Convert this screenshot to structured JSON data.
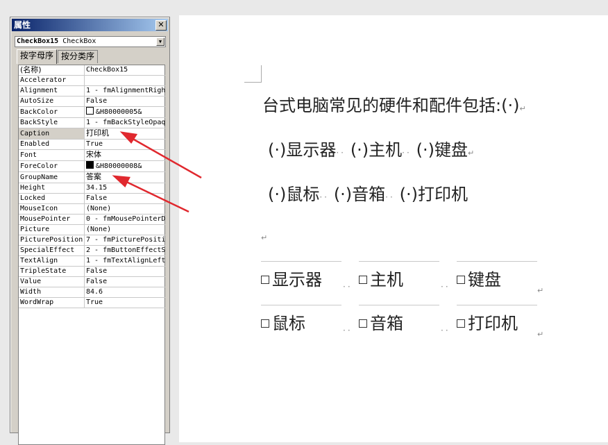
{
  "properties_window": {
    "title": "属性",
    "close_glyph": "✕",
    "object_selector": {
      "name": "CheckBox15",
      "type": "CheckBox"
    },
    "tabs": [
      {
        "label": "按字母序",
        "active": true
      },
      {
        "label": "按分类序",
        "active": false
      }
    ],
    "rows": [
      {
        "key": "(名称)",
        "value": "CheckBox15"
      },
      {
        "key": "Accelerator",
        "value": ""
      },
      {
        "key": "Alignment",
        "value": "1 - fmAlignmentRigh"
      },
      {
        "key": "AutoSize",
        "value": "False"
      },
      {
        "key": "BackColor",
        "value": "&H80000005&",
        "swatch": "#ffffff"
      },
      {
        "key": "BackStyle",
        "value": "1 - fmBackStyleOpaq"
      },
      {
        "key": "Caption",
        "value": "打印机",
        "selected": true
      },
      {
        "key": "Enabled",
        "value": "True"
      },
      {
        "key": "Font",
        "value": "宋体"
      },
      {
        "key": "ForeColor",
        "value": "&H80000008&",
        "swatch": "#000000"
      },
      {
        "key": "GroupName",
        "value": "答案"
      },
      {
        "key": "Height",
        "value": "34.15"
      },
      {
        "key": "Locked",
        "value": "False"
      },
      {
        "key": "MouseIcon",
        "value": "(None)"
      },
      {
        "key": "MousePointer",
        "value": "0 - fmMousePointerD"
      },
      {
        "key": "Picture",
        "value": "(None)"
      },
      {
        "key": "PicturePosition",
        "value": "7 - fmPicturePositi"
      },
      {
        "key": "SpecialEffect",
        "value": "2 - fmButtonEffectS"
      },
      {
        "key": "TextAlign",
        "value": "1 - fmTextAlignLeft"
      },
      {
        "key": "TripleState",
        "value": "False"
      },
      {
        "key": "Value",
        "value": "False"
      },
      {
        "key": "Width",
        "value": "84.6"
      },
      {
        "key": "WordWrap",
        "value": "True"
      }
    ]
  },
  "document": {
    "question": "台式电脑常见的硬件和配件包括:(·)",
    "line2": [
      "(·)显示器",
      "(·)主机",
      "(·)键盘"
    ],
    "line3": [
      "(·)鼠标",
      "(·)音箱",
      "(·)打印机"
    ],
    "paragraph_mark": "↵",
    "checkboxes_row1": [
      "显示器",
      "主机",
      "键盘"
    ],
    "checkboxes_row2": [
      "鼠标",
      "音箱",
      "打印机"
    ]
  },
  "colors": {
    "arrow": "#e0282e",
    "title_bar": "#0a246a"
  }
}
